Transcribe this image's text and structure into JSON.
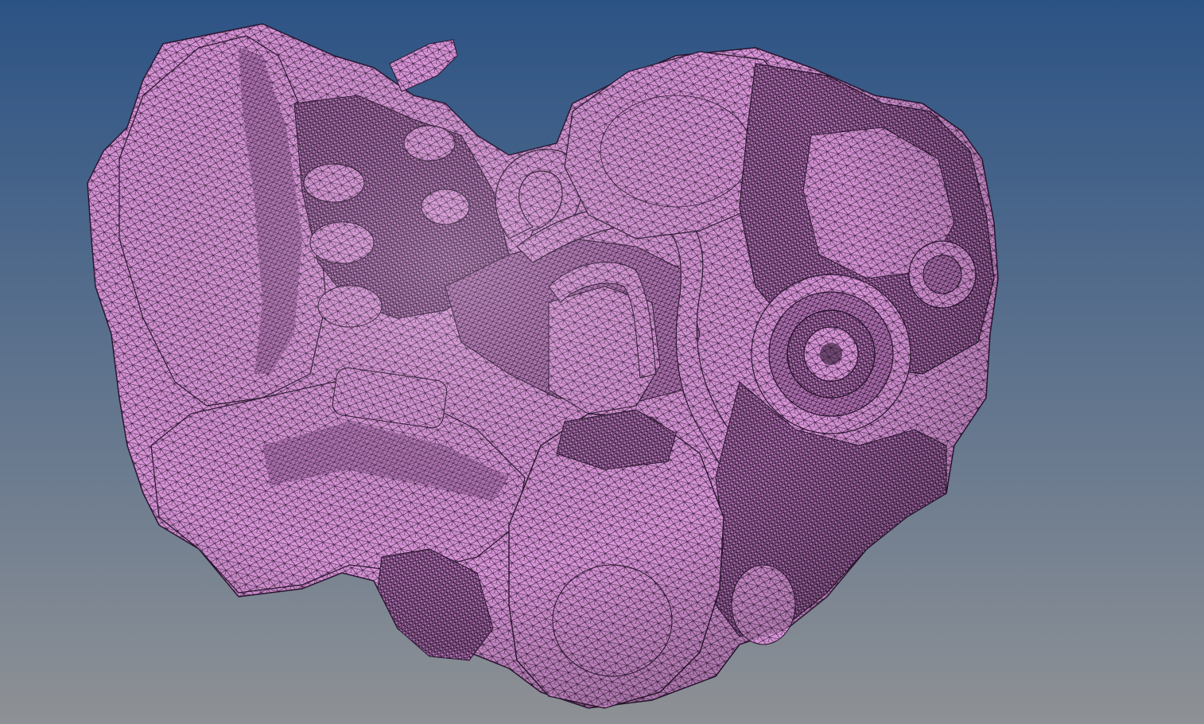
{
  "viewport": {
    "background_top_color": "#2c5385",
    "background_bottom_color": "#8e9195",
    "render_mode": "wireframe-on-shaded",
    "model": {
      "subject": "engine-block-mesh",
      "face_color": "#d995d8",
      "face_shadow_color": "#b876b9",
      "mesh_line_color": "#2a1530"
    }
  }
}
